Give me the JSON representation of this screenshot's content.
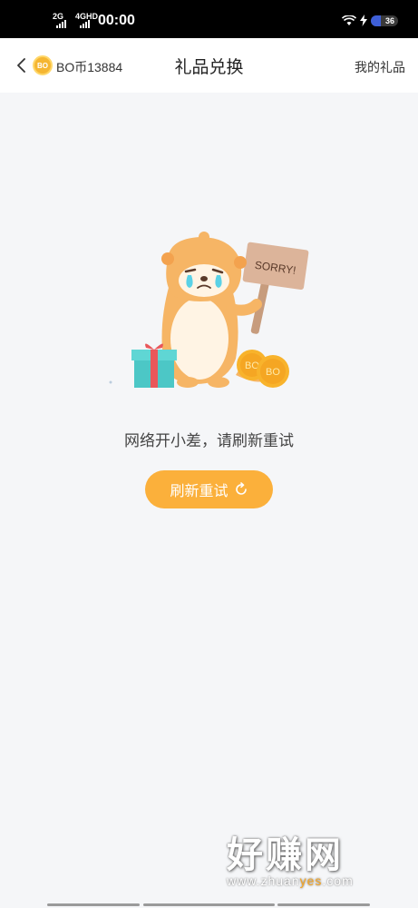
{
  "status_bar": {
    "net1": "2G",
    "net2": "4GHD",
    "time": "00:00",
    "battery_level": "36"
  },
  "header": {
    "coin_badge": "BO",
    "coin_balance": "BO币13884",
    "title": "礼品兑换",
    "my_gifts": "我的礼品"
  },
  "illustration": {
    "sign_text": "SORRY!",
    "coin_label": "BO"
  },
  "content": {
    "message": "网络开小差，请刷新重试",
    "refresh_label": "刷新重试"
  },
  "watermark": {
    "title": "好赚网",
    "url_prefix": "www.zhuan",
    "url_highlight": "yes",
    "url_suffix": ".com"
  },
  "colors": {
    "accent": "#fbb03b",
    "coin": "#f5b632",
    "background": "#f5f6f8"
  }
}
